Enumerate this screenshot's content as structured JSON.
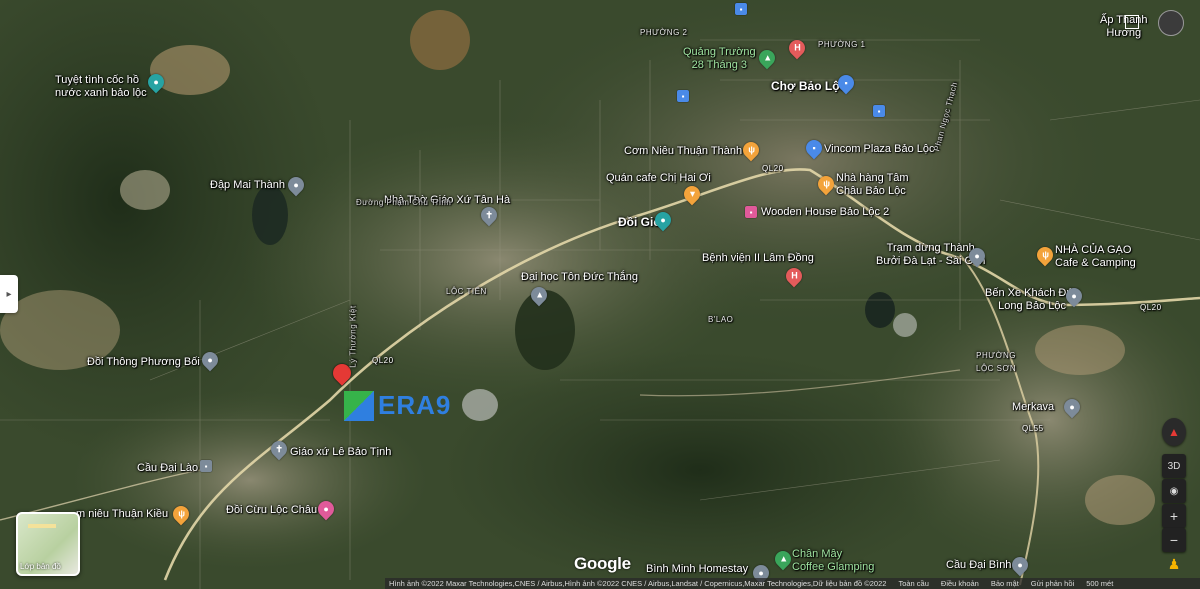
{
  "places": {
    "phuong2": "PHƯỜNG 2",
    "phuong1": "PHƯỜNG 1",
    "quang_truong": "Quảng Trường\n28 Tháng 3",
    "cho": "Chợ Bảo Lộc",
    "tuyet_tinh": "Tuyệt tình cốc hồ\nnước xanh bảo lộc",
    "dap_mai_thanh": "Đập Mai Thành",
    "com_nieu": "Cơm Niêu Thuận Thành",
    "vincom": "Vincom Plaza Bảo Lộc",
    "quan_cafe": "Quán cafe Chị Hai Ơi",
    "nha_hang": "Nhà hàng Tâm\nChâu Bảo Lộc",
    "nha_tho": "Nhà Thờ Giáo Xứ Tân Hà",
    "doi_gio": "Đồi Gió",
    "wooden": "Wooden House Bảo Lộc 2",
    "ben_vien": "Bệnh viện II Lâm Đồng",
    "tram_dung": "Trạm dừng Thành\nBưởi Đà Lạt - Sài Gòn",
    "nha_cua_gao": "NHÀ CỦA GẠO\nCafe & Camping",
    "loc_tien": "LỘC TIẾN",
    "dai_hoc": "Đại học Tôn Đức Thắng",
    "ben_xe": "Bến Xe Khách Đức\nLong Bảo Lộc",
    "b_lao": "B'LAO",
    "doi_thong": "Đồi Thông Phương Bối",
    "phuong_loc_son": "PHƯỜNG\nLỘC SƠN",
    "merkava": "Merkava",
    "giao_xu": "Giáo xứ Lê Bảo Tịnh",
    "cau_dai_lao": "Cầu Đại Lào",
    "com_nieu_thuan_kieu": "m niêu Thuận Kiều",
    "doi_cuu": "Đồi Cừu Lộc Châu",
    "binh_minh": "Bình Minh Homestay",
    "chan_may": "Chân Mây\nCoffee Glamping",
    "cau_dai_binh": "Cầu Đại Bình",
    "ap_thanh_huong": "Ấp Thanh\nHương",
    "ql20_a": "QL20",
    "ql20_b": "QL20",
    "ql20_c": "QL20",
    "ql55": "QL55",
    "duong_phan_chu_trinh": "Đường Phạm Chu Trinh",
    "ly_thuong_kiet": "Lý Thường Kiệt",
    "phan_ngoc_thach": "Phan Ngọc Thạch"
  },
  "watermark": "ERA9",
  "google_logo": "Google",
  "layer_button": "Lớp bản đồ",
  "side_tab_icon": "chevron-right",
  "controls": {
    "view3d": "3D",
    "zoom_in": "+",
    "zoom_out": "−"
  },
  "footer": {
    "attribution": "Hình ảnh ©2022 Maxar Technologies,CNES / Airbus,Hình ảnh ©2022 CNES / Airbus,Landsat / Copernicus,Maxar Technologies,Dữ liệu bản đồ ©2022",
    "links": [
      "Toàn cầu",
      "Điều khoản",
      "Bảo mật",
      "Gửi phản hồi"
    ],
    "scale": "500 mét"
  },
  "colors": {
    "hospital": "#e45b5b",
    "restaurant": "#f3a33b",
    "shop": "#4a8ae8",
    "pin_red": "#e53935",
    "watermark": "#2f7fe0"
  }
}
